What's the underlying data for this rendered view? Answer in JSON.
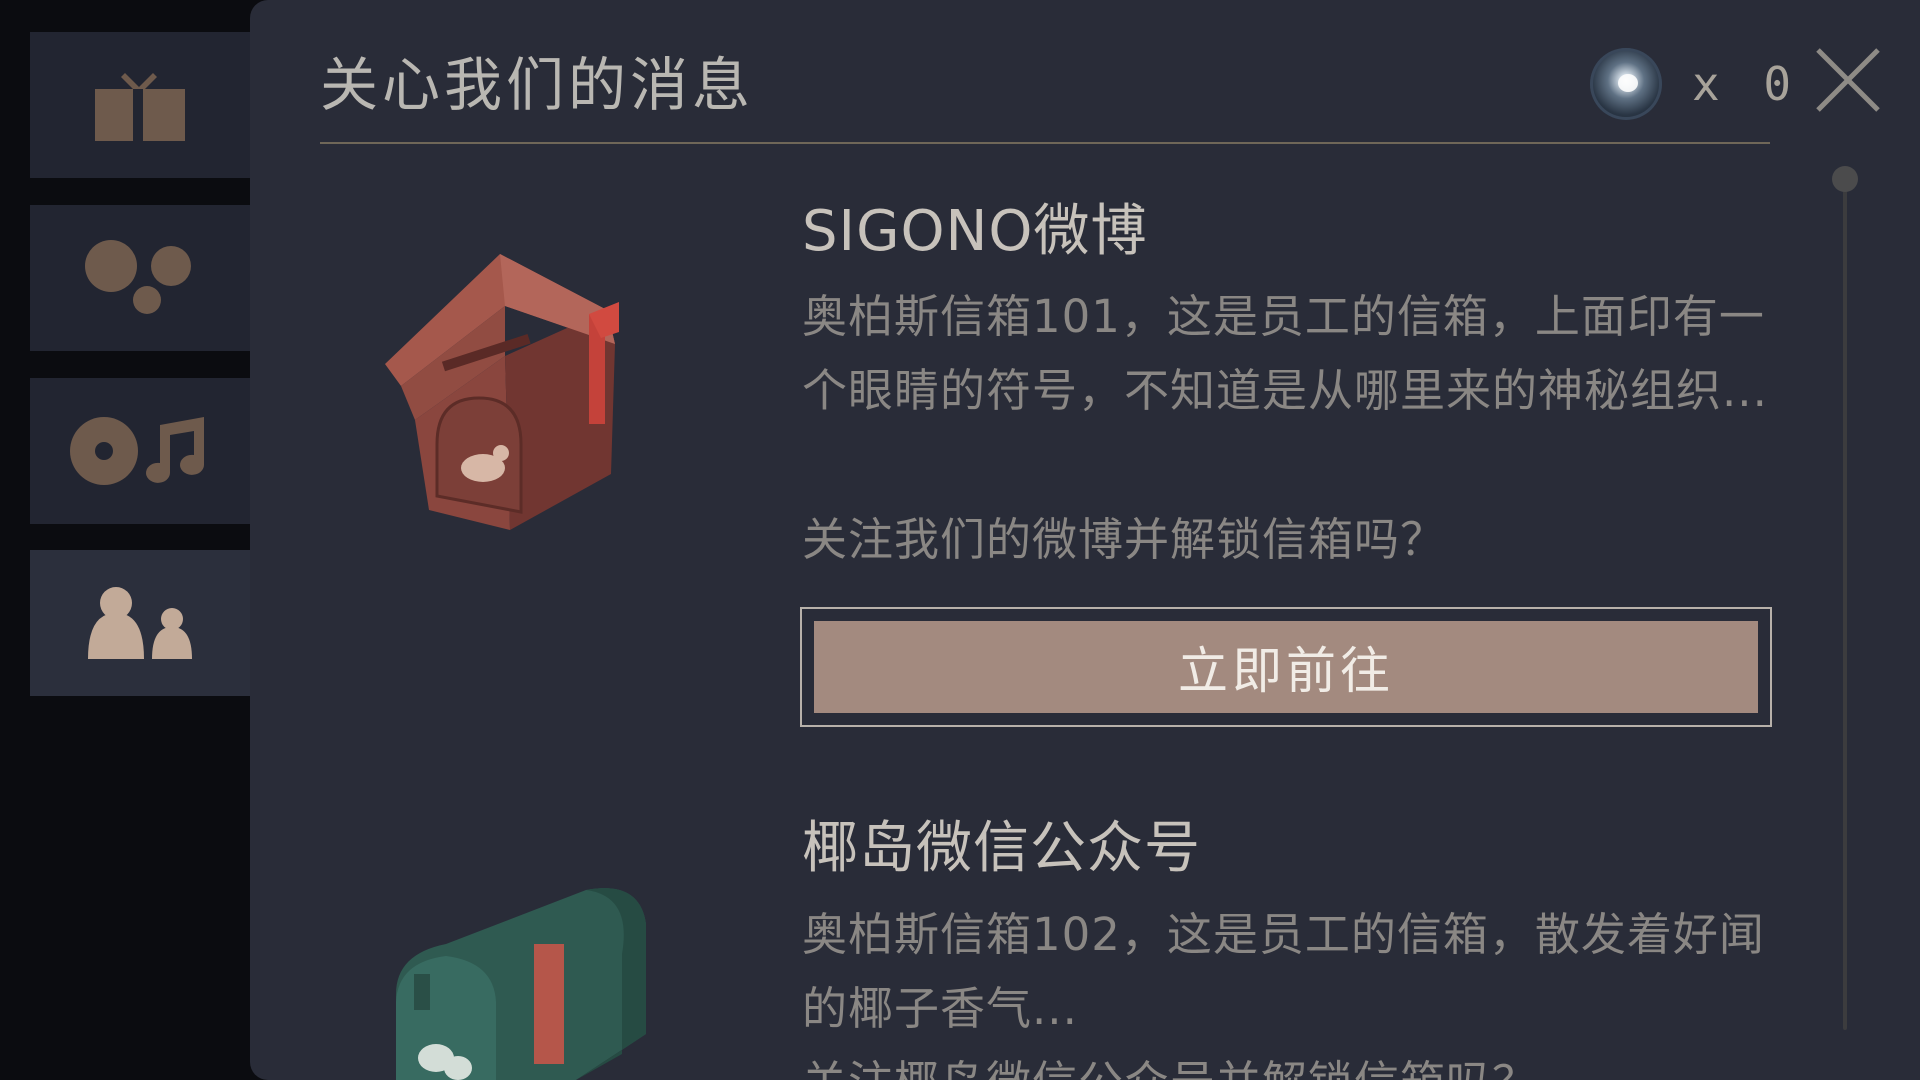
{
  "header": {
    "title": "关心我们的消息",
    "currency_count": "x 0"
  },
  "sidebar": {
    "tabs": [
      {
        "icon": "gift-icon"
      },
      {
        "icon": "dots-icon"
      },
      {
        "icon": "music-icon"
      },
      {
        "icon": "people-icon",
        "selected": true
      }
    ]
  },
  "cards": [
    {
      "title": "SIGONO微博",
      "description": "奥柏斯信箱101，这是员工的信箱，上面印有一个眼睛的符号，不知道是从哪里来的神秘组织...",
      "question": "关注我们的微博并解锁信箱吗？",
      "button_label": "立即前往",
      "icon": "weibo-mailbox-icon"
    },
    {
      "title": "椰岛微信公众号",
      "description": "奥柏斯信箱102，这是员工的信箱，散发着好闻的椰子香气...",
      "question": "关注椰岛微信公众号并解锁信箱吗？",
      "icon": "wechat-mailbox-icon"
    }
  ],
  "colors": {
    "panel_bg": "#292c38",
    "sidebar_tab_bg": "#222531",
    "icon_tan": "#6e5a4c",
    "accent_button": "#a38a7f",
    "title_text": "#c7c2bb",
    "body_text": "#8a8784"
  }
}
